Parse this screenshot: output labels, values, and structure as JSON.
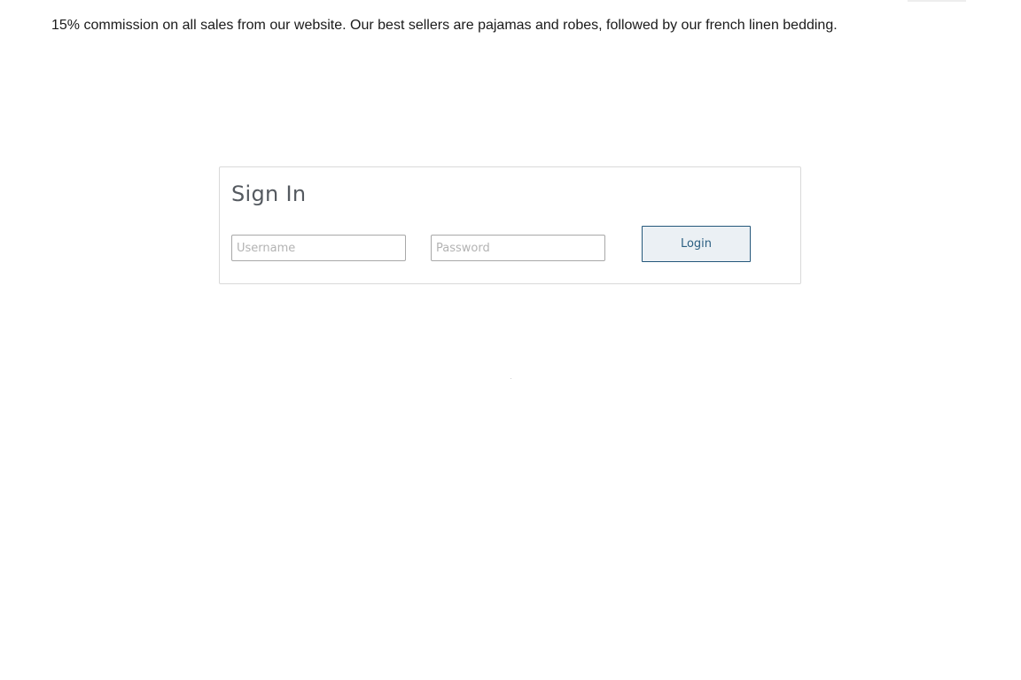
{
  "intro": {
    "text": "15% commission on all sales from our website. Our best sellers are pajamas and robes, followed by our french linen bedding."
  },
  "signin": {
    "title": "Sign In",
    "username": {
      "placeholder": "Username",
      "value": ""
    },
    "password": {
      "placeholder": "Password",
      "value": ""
    },
    "login_label": "Login"
  },
  "colors": {
    "title_text": "#555a60",
    "button_border": "#24577a",
    "button_bg": "#ebf0f4",
    "button_text": "#2b5f82",
    "panel_border": "#d9d9d9"
  }
}
